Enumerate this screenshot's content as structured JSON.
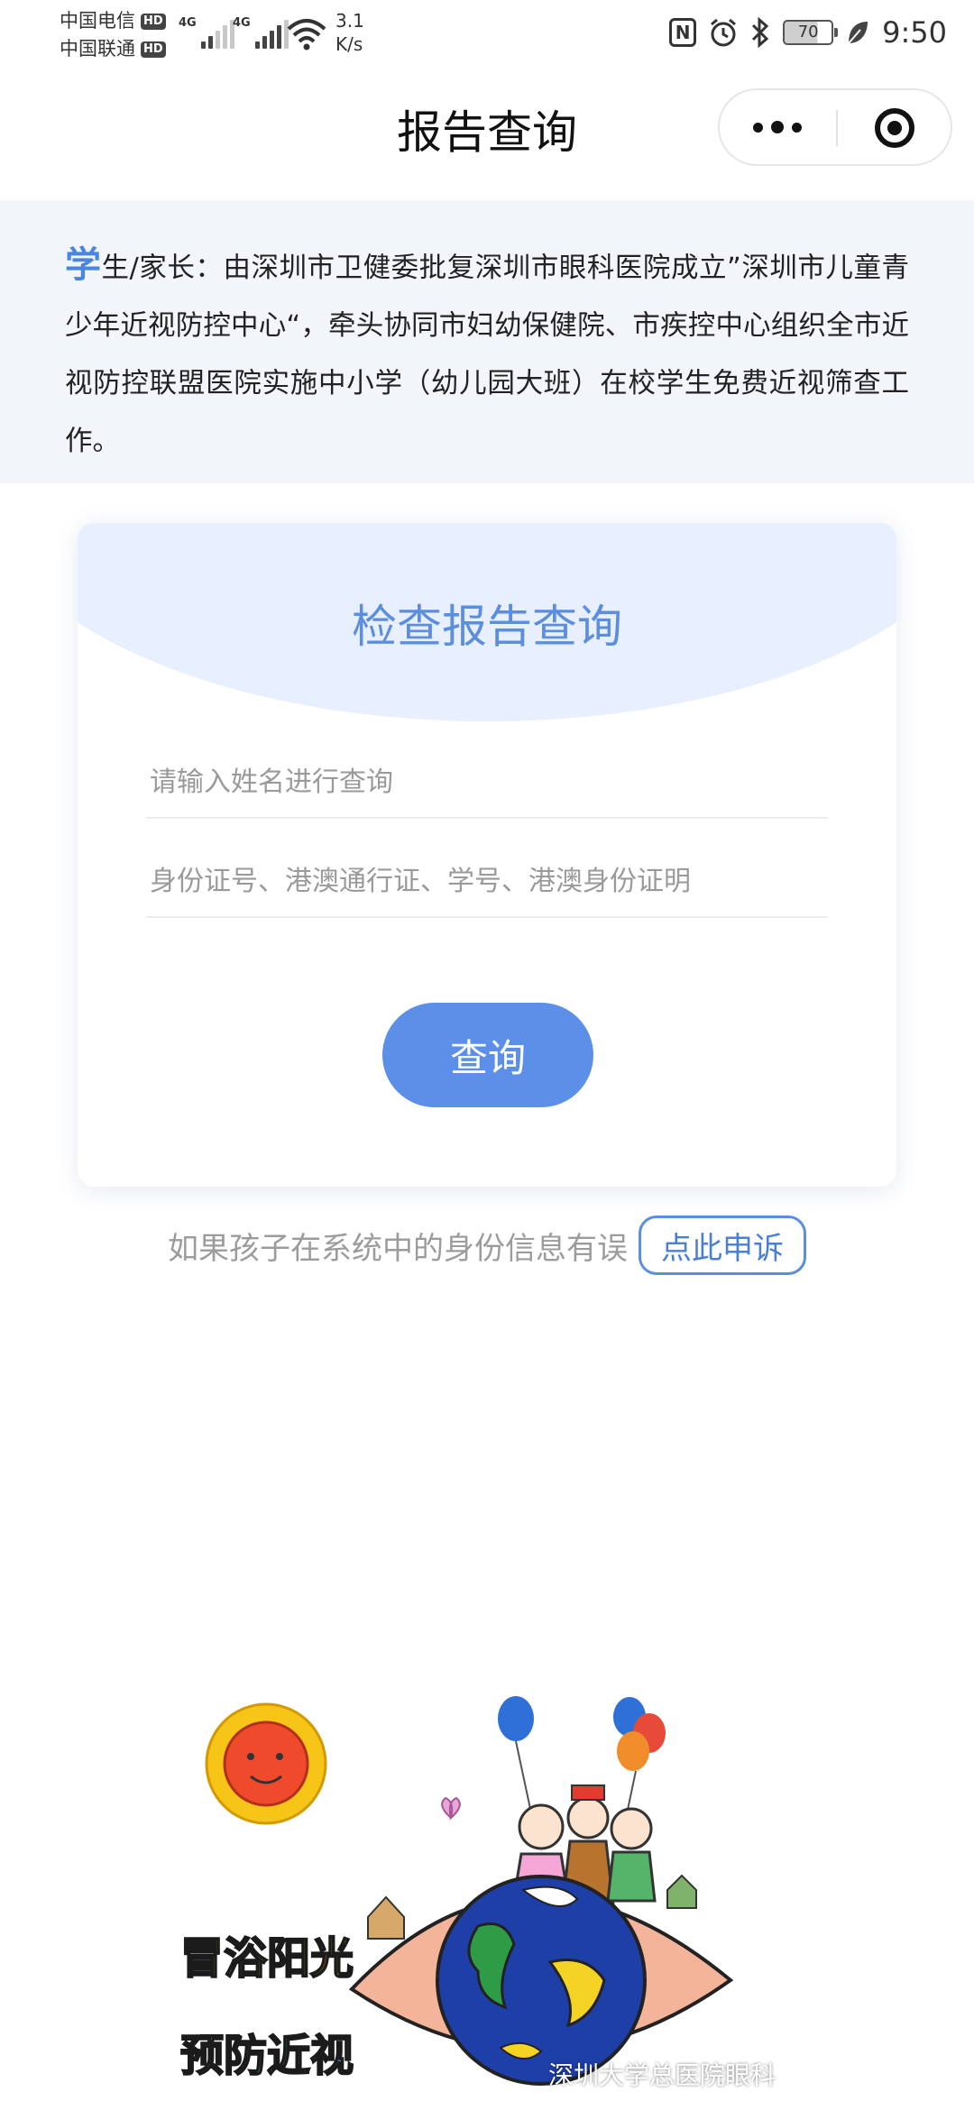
{
  "status_bar": {
    "carrier1": "中国电信",
    "carrier2": "中国联通",
    "hd_badge": "HD",
    "network1": "4G",
    "network2": "4G",
    "speed_value": "3.1",
    "speed_unit": "K/s",
    "nfc": "N",
    "battery": "70",
    "time": "9:50"
  },
  "nav": {
    "title": "报告查询"
  },
  "notice": {
    "first_char": "学",
    "text": "生/家长：由深圳市卫健委批复深圳市眼科医院成立”深圳市儿童青少年近视防控中心“，牵头协同市妇幼保健院、市疾控中心组织全市近视防控联盟医院实施中小学（幼儿园大班）在校学生免费近视筛查工作。"
  },
  "card": {
    "title": "检查报告查询",
    "name_placeholder": "请输入姓名进行查询",
    "id_placeholder": "身份证号、港澳通行证、学号、港澳身份证明",
    "query_button": "查询"
  },
  "appeal": {
    "text": "如果孩子在系统中的身份信息有误",
    "button": "点此申诉"
  },
  "illustration": {
    "slogan1": "冒浴阳光",
    "slogan2": "预防近视",
    "watermark": "深圳大学总医院眼科"
  },
  "colors": {
    "accent": "#5b8fe8",
    "notice_bg": "#f2f6fb",
    "arc_bg": "#e8efff"
  }
}
